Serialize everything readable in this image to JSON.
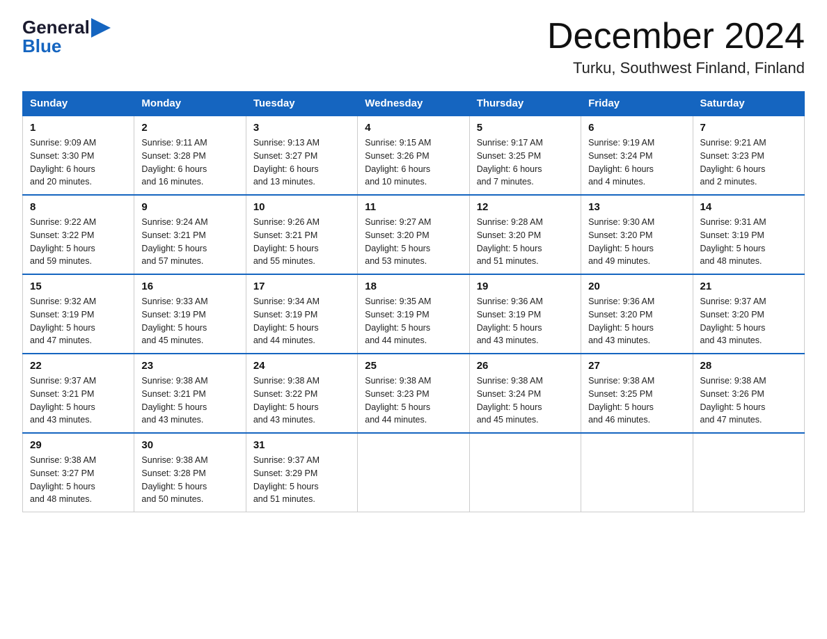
{
  "header": {
    "logo": {
      "general": "General",
      "blue": "Blue",
      "arrow": "▶"
    },
    "title": "December 2024",
    "location": "Turku, Southwest Finland, Finland"
  },
  "days_of_week": [
    "Sunday",
    "Monday",
    "Tuesday",
    "Wednesday",
    "Thursday",
    "Friday",
    "Saturday"
  ],
  "weeks": [
    [
      {
        "day": "1",
        "sunrise": "Sunrise: 9:09 AM",
        "sunset": "Sunset: 3:30 PM",
        "daylight": "Daylight: 6 hours",
        "daylight2": "and 20 minutes."
      },
      {
        "day": "2",
        "sunrise": "Sunrise: 9:11 AM",
        "sunset": "Sunset: 3:28 PM",
        "daylight": "Daylight: 6 hours",
        "daylight2": "and 16 minutes."
      },
      {
        "day": "3",
        "sunrise": "Sunrise: 9:13 AM",
        "sunset": "Sunset: 3:27 PM",
        "daylight": "Daylight: 6 hours",
        "daylight2": "and 13 minutes."
      },
      {
        "day": "4",
        "sunrise": "Sunrise: 9:15 AM",
        "sunset": "Sunset: 3:26 PM",
        "daylight": "Daylight: 6 hours",
        "daylight2": "and 10 minutes."
      },
      {
        "day": "5",
        "sunrise": "Sunrise: 9:17 AM",
        "sunset": "Sunset: 3:25 PM",
        "daylight": "Daylight: 6 hours",
        "daylight2": "and 7 minutes."
      },
      {
        "day": "6",
        "sunrise": "Sunrise: 9:19 AM",
        "sunset": "Sunset: 3:24 PM",
        "daylight": "Daylight: 6 hours",
        "daylight2": "and 4 minutes."
      },
      {
        "day": "7",
        "sunrise": "Sunrise: 9:21 AM",
        "sunset": "Sunset: 3:23 PM",
        "daylight": "Daylight: 6 hours",
        "daylight2": "and 2 minutes."
      }
    ],
    [
      {
        "day": "8",
        "sunrise": "Sunrise: 9:22 AM",
        "sunset": "Sunset: 3:22 PM",
        "daylight": "Daylight: 5 hours",
        "daylight2": "and 59 minutes."
      },
      {
        "day": "9",
        "sunrise": "Sunrise: 9:24 AM",
        "sunset": "Sunset: 3:21 PM",
        "daylight": "Daylight: 5 hours",
        "daylight2": "and 57 minutes."
      },
      {
        "day": "10",
        "sunrise": "Sunrise: 9:26 AM",
        "sunset": "Sunset: 3:21 PM",
        "daylight": "Daylight: 5 hours",
        "daylight2": "and 55 minutes."
      },
      {
        "day": "11",
        "sunrise": "Sunrise: 9:27 AM",
        "sunset": "Sunset: 3:20 PM",
        "daylight": "Daylight: 5 hours",
        "daylight2": "and 53 minutes."
      },
      {
        "day": "12",
        "sunrise": "Sunrise: 9:28 AM",
        "sunset": "Sunset: 3:20 PM",
        "daylight": "Daylight: 5 hours",
        "daylight2": "and 51 minutes."
      },
      {
        "day": "13",
        "sunrise": "Sunrise: 9:30 AM",
        "sunset": "Sunset: 3:20 PM",
        "daylight": "Daylight: 5 hours",
        "daylight2": "and 49 minutes."
      },
      {
        "day": "14",
        "sunrise": "Sunrise: 9:31 AM",
        "sunset": "Sunset: 3:19 PM",
        "daylight": "Daylight: 5 hours",
        "daylight2": "and 48 minutes."
      }
    ],
    [
      {
        "day": "15",
        "sunrise": "Sunrise: 9:32 AM",
        "sunset": "Sunset: 3:19 PM",
        "daylight": "Daylight: 5 hours",
        "daylight2": "and 47 minutes."
      },
      {
        "day": "16",
        "sunrise": "Sunrise: 9:33 AM",
        "sunset": "Sunset: 3:19 PM",
        "daylight": "Daylight: 5 hours",
        "daylight2": "and 45 minutes."
      },
      {
        "day": "17",
        "sunrise": "Sunrise: 9:34 AM",
        "sunset": "Sunset: 3:19 PM",
        "daylight": "Daylight: 5 hours",
        "daylight2": "and 44 minutes."
      },
      {
        "day": "18",
        "sunrise": "Sunrise: 9:35 AM",
        "sunset": "Sunset: 3:19 PM",
        "daylight": "Daylight: 5 hours",
        "daylight2": "and 44 minutes."
      },
      {
        "day": "19",
        "sunrise": "Sunrise: 9:36 AM",
        "sunset": "Sunset: 3:19 PM",
        "daylight": "Daylight: 5 hours",
        "daylight2": "and 43 minutes."
      },
      {
        "day": "20",
        "sunrise": "Sunrise: 9:36 AM",
        "sunset": "Sunset: 3:20 PM",
        "daylight": "Daylight: 5 hours",
        "daylight2": "and 43 minutes."
      },
      {
        "day": "21",
        "sunrise": "Sunrise: 9:37 AM",
        "sunset": "Sunset: 3:20 PM",
        "daylight": "Daylight: 5 hours",
        "daylight2": "and 43 minutes."
      }
    ],
    [
      {
        "day": "22",
        "sunrise": "Sunrise: 9:37 AM",
        "sunset": "Sunset: 3:21 PM",
        "daylight": "Daylight: 5 hours",
        "daylight2": "and 43 minutes."
      },
      {
        "day": "23",
        "sunrise": "Sunrise: 9:38 AM",
        "sunset": "Sunset: 3:21 PM",
        "daylight": "Daylight: 5 hours",
        "daylight2": "and 43 minutes."
      },
      {
        "day": "24",
        "sunrise": "Sunrise: 9:38 AM",
        "sunset": "Sunset: 3:22 PM",
        "daylight": "Daylight: 5 hours",
        "daylight2": "and 43 minutes."
      },
      {
        "day": "25",
        "sunrise": "Sunrise: 9:38 AM",
        "sunset": "Sunset: 3:23 PM",
        "daylight": "Daylight: 5 hours",
        "daylight2": "and 44 minutes."
      },
      {
        "day": "26",
        "sunrise": "Sunrise: 9:38 AM",
        "sunset": "Sunset: 3:24 PM",
        "daylight": "Daylight: 5 hours",
        "daylight2": "and 45 minutes."
      },
      {
        "day": "27",
        "sunrise": "Sunrise: 9:38 AM",
        "sunset": "Sunset: 3:25 PM",
        "daylight": "Daylight: 5 hours",
        "daylight2": "and 46 minutes."
      },
      {
        "day": "28",
        "sunrise": "Sunrise: 9:38 AM",
        "sunset": "Sunset: 3:26 PM",
        "daylight": "Daylight: 5 hours",
        "daylight2": "and 47 minutes."
      }
    ],
    [
      {
        "day": "29",
        "sunrise": "Sunrise: 9:38 AM",
        "sunset": "Sunset: 3:27 PM",
        "daylight": "Daylight: 5 hours",
        "daylight2": "and 48 minutes."
      },
      {
        "day": "30",
        "sunrise": "Sunrise: 9:38 AM",
        "sunset": "Sunset: 3:28 PM",
        "daylight": "Daylight: 5 hours",
        "daylight2": "and 50 minutes."
      },
      {
        "day": "31",
        "sunrise": "Sunrise: 9:37 AM",
        "sunset": "Sunset: 3:29 PM",
        "daylight": "Daylight: 5 hours",
        "daylight2": "and 51 minutes."
      },
      null,
      null,
      null,
      null
    ]
  ],
  "colors": {
    "header_bg": "#1565c0",
    "border_top": "#1565c0",
    "logo_dark": "#1a1a2e",
    "logo_blue": "#1565c0"
  }
}
